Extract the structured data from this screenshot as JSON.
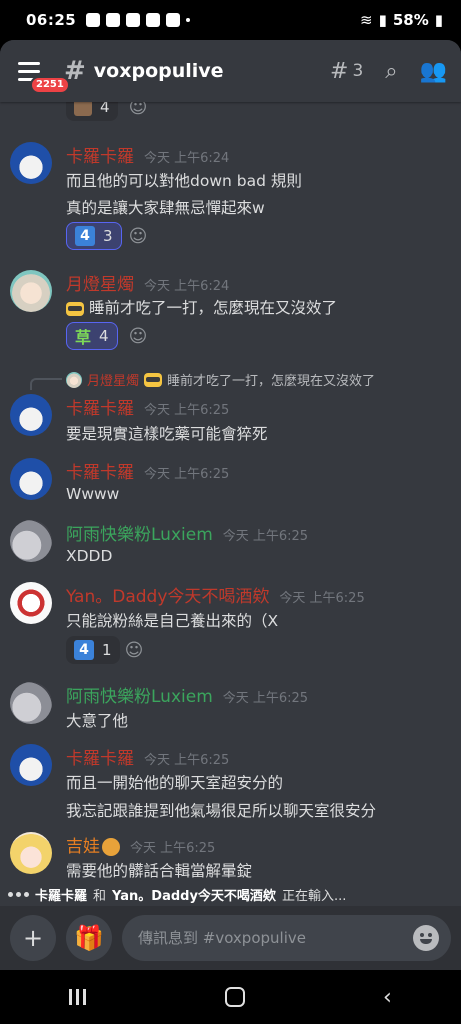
{
  "status": {
    "time": "06:25",
    "battery": "58%"
  },
  "header": {
    "badge": "2251",
    "channel": "voxpopulive",
    "threads_count": "3"
  },
  "colors": {
    "background": "#36393f",
    "karo": "#c0392b",
    "moon": "#c0392b",
    "rain": "#3ba55d",
    "yan": "#c0392b",
    "jiwa": "#e67e22"
  },
  "messages": {
    "top_reaction_count": "4",
    "m1": {
      "author": "卡羅卡羅",
      "time": "今天 上午6:24",
      "line1": "而且他的可以對他down bad 規則",
      "line2": "真的是讓大家肆無忌憚起來w",
      "reaction_count": "3"
    },
    "m2": {
      "author": "月燈星燭",
      "time": "今天 上午6:24",
      "line1": "睡前才吃了一打，怎麼現在又沒效了",
      "reaction_emoji": "草",
      "reaction_count": "4"
    },
    "reply": {
      "author": "月燈星燭",
      "text": "睡前才吃了一打，怎麼現在又沒效了"
    },
    "m3": {
      "author": "卡羅卡羅",
      "time": "今天 上午6:25",
      "line1": "要是現實這樣吃藥可能會猝死"
    },
    "m4": {
      "author": "卡羅卡羅",
      "time": "今天 上午6:25",
      "line1": "Wwww"
    },
    "m5": {
      "author": "阿雨快樂粉Luxiem",
      "time": "今天 上午6:25",
      "line1": "XDDD"
    },
    "m6": {
      "author": "Yan。Daddy今天不喝酒欸",
      "time": "今天 上午6:25",
      "line1": "只能說粉絲是自己養出來的（X",
      "reaction_count": "1"
    },
    "m7": {
      "author": "阿雨快樂粉Luxiem",
      "time": "今天 上午6:25",
      "line1": "大意了他"
    },
    "m8": {
      "author": "卡羅卡羅",
      "time": "今天 上午6:25",
      "line1": "而且一開始他的聊天室超安分的",
      "line2": "我忘記跟誰提到他氣場很足所以聊天室很安分"
    },
    "m9": {
      "author": "吉娃",
      "time": "今天 上午6:25",
      "line1": "需要他的髒話合輯當解暈錠"
    }
  },
  "typing": {
    "user1": "卡羅卡羅",
    "conj": "和",
    "user2": "Yan。Daddy今天不喝酒欸",
    "suffix": "正在輸入..."
  },
  "composer": {
    "placeholder": "傳訊息到 #voxpopulive"
  }
}
